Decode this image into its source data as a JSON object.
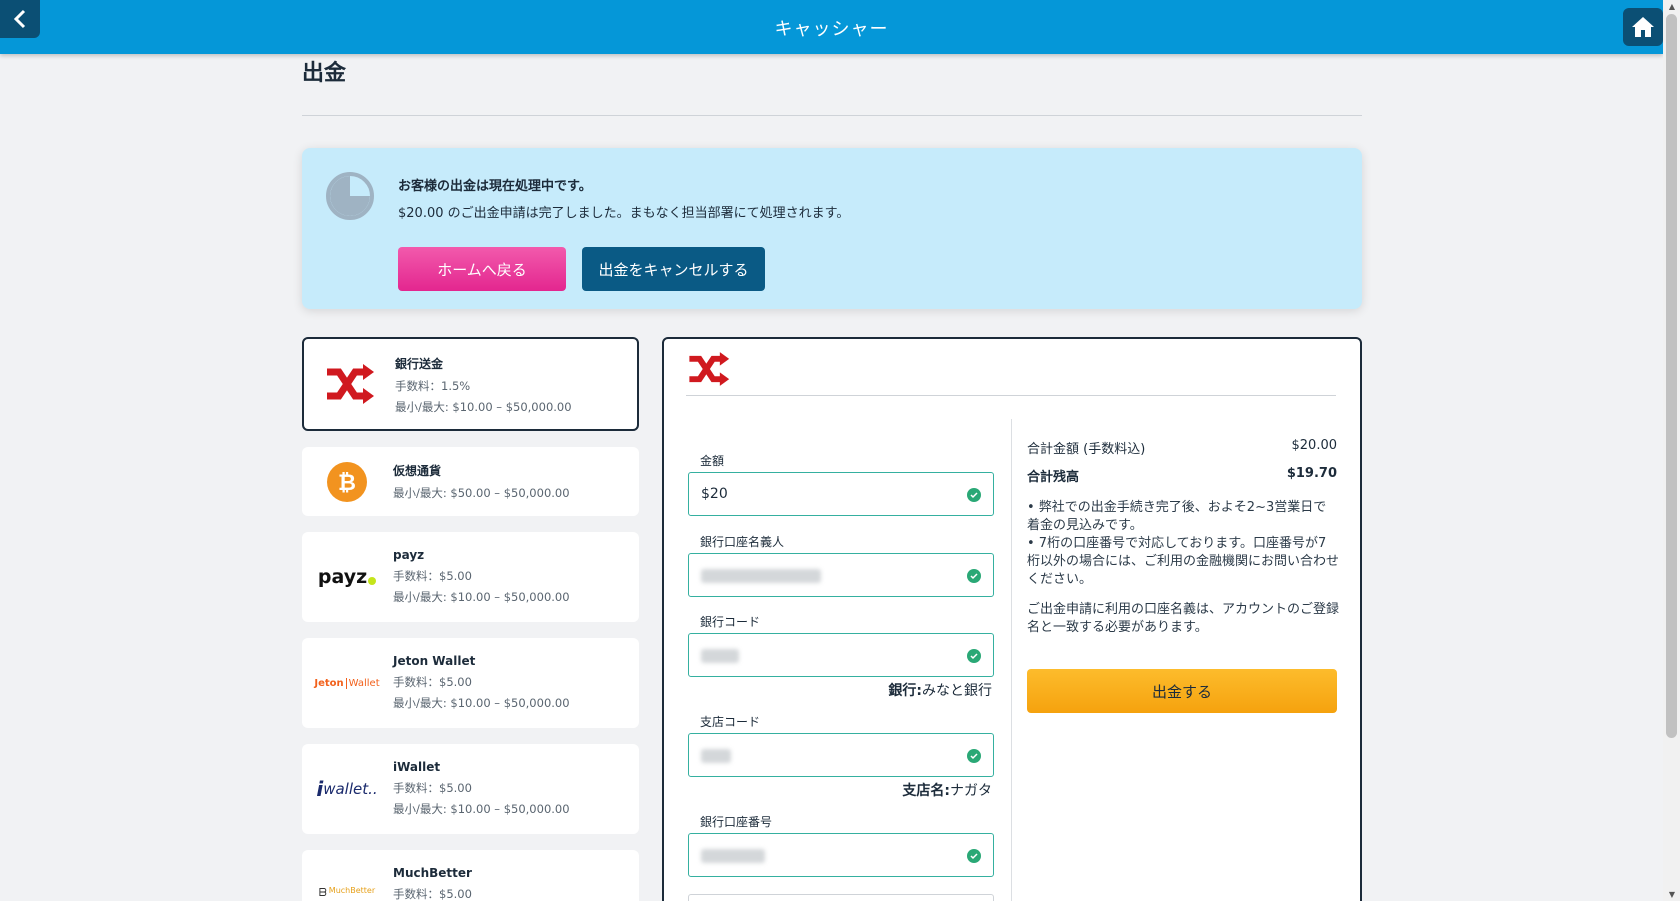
{
  "header": {
    "title": "キャッシャー",
    "back_icon": "chevron-left-icon",
    "home_icon": "home-icon"
  },
  "page": {
    "title": "出金"
  },
  "notice": {
    "heading": "お客様の出金は現在処理中です。",
    "text": "$20.00 のご出金申請は完了しました。まもなく担当部署にて処理されます。",
    "home_button": "ホームへ戻る",
    "cancel_button": "出金をキャンセルする"
  },
  "methods": [
    {
      "name": "銀行送金",
      "fee": "手数料：1.5%",
      "range": "最小/最大: $10.00 – $50,000.00",
      "icon": "bank-transfer-icon",
      "selected": true
    },
    {
      "name": "仮想通貨",
      "range": "最小/最大: $50.00 – $50,000.00",
      "icon": "bitcoin-icon"
    },
    {
      "name": "payz",
      "fee": "手数料：$5.00",
      "range": "最小/最大: $10.00 – $50,000.00",
      "icon": "payz-logo",
      "logo_text": "payz"
    },
    {
      "name": "Jeton Wallet",
      "fee": "手数料：$5.00",
      "range": "最小/最大: $10.00 – $50,000.00",
      "icon": "jeton-logo",
      "logo_text_a": "Jeton",
      "logo_text_b": "Wallet"
    },
    {
      "name": "iWallet",
      "fee": "手数料：$5.00",
      "range": "最小/最大: $10.00 – $50,000.00",
      "icon": "iwallet-logo",
      "logo_text": "wallet.."
    },
    {
      "name": "MuchBetter",
      "fee": "手数料：$5.00",
      "icon": "muchbetter-logo",
      "logo_text": "MuchBetter"
    }
  ],
  "form": {
    "amount_label": "金額",
    "amount_value": "$20",
    "holder_label": "銀行口座名義人",
    "bank_code_label": "銀行コード",
    "bank_note_label": "銀行:",
    "bank_note_value": "みなと銀行",
    "branch_code_label": "支店コード",
    "branch_note_label": "支店名:",
    "branch_note_value": "ナガタ",
    "account_label": "銀行口座番号"
  },
  "summary": {
    "total_label": "合計金額 (手数料込)",
    "total_value": "$20.00",
    "balance_label": "合計残高",
    "balance_value": "$19.70",
    "note1": "• 弊社での出金手続き完了後、およそ2~3営業日で着金の見込みです。",
    "note2": "• 7桁の口座番号で対応しております。口座番号が7桁以外の場合には、ご利用の金融機関にお問い合わせください。",
    "note3": "ご出金申請に利用の口座名義は、アカウントのご登録名と一致する必要があります。",
    "withdraw_button": "出金する"
  },
  "colors": {
    "header": "#0597d8",
    "accent_pink": "#e3268f",
    "accent_navy": "#0a5a85",
    "accent_orange": "#f5a20e",
    "notice_bg": "#c6ebfb",
    "valid_green": "#2aa876"
  }
}
